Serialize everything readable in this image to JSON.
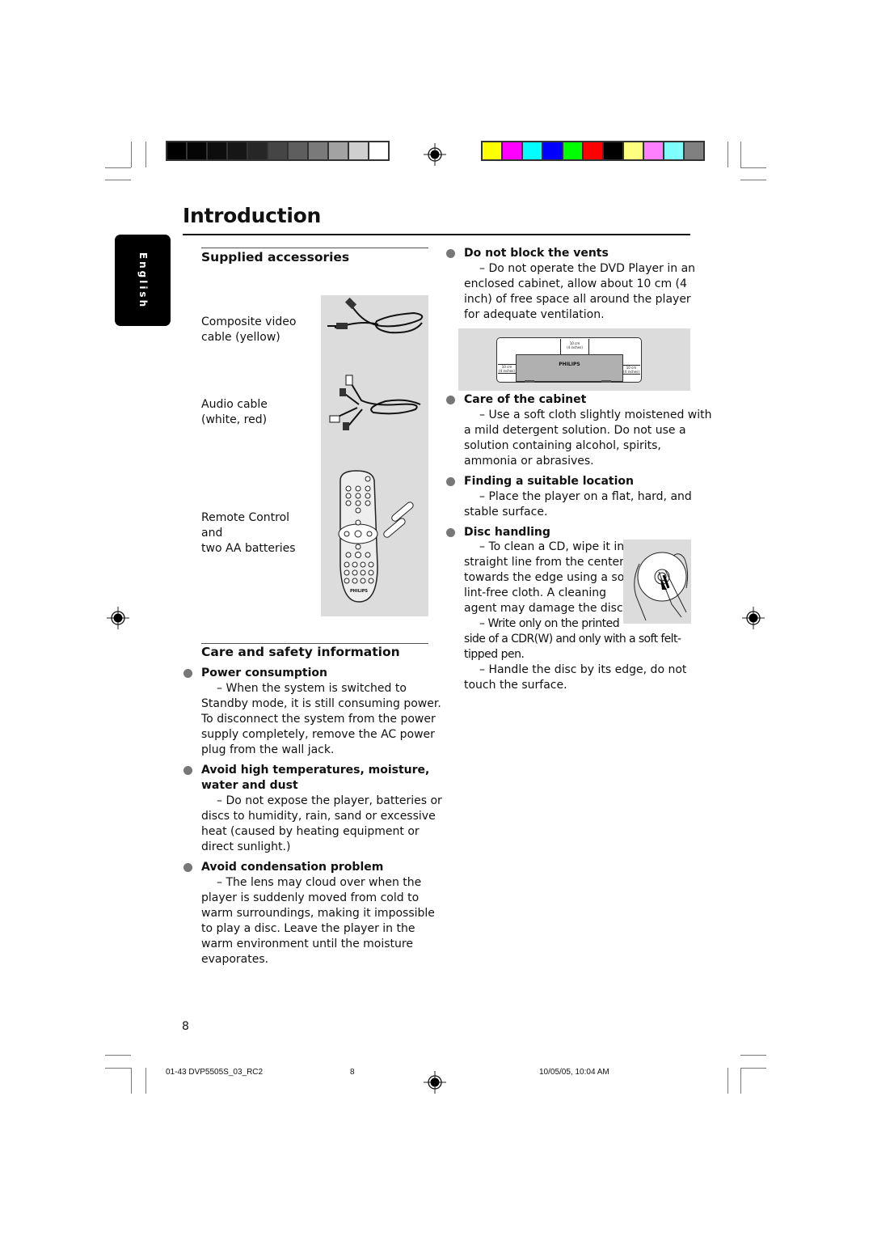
{
  "page": {
    "title": "Introduction",
    "language_tab": "English",
    "page_number": "8"
  },
  "color_bars": {
    "grayscale": [
      "#000000",
      "#050505",
      "#0d0d0d",
      "#161616",
      "#262626",
      "#454545",
      "#5e5e5e",
      "#7a7a7a",
      "#a2a2a2",
      "#cfcfcf",
      "#ffffff"
    ],
    "colors": [
      "#ffff00",
      "#ff00ff",
      "#00ffff",
      "#0000ff",
      "#00ff00",
      "#ff0000",
      "#000000",
      "#ffff80",
      "#ff80ff",
      "#80ffff",
      "#808080"
    ]
  },
  "supplied_accessories": {
    "heading": "Supplied accessories",
    "items": [
      {
        "label_line1": "Composite video",
        "label_line2": "cable (yellow)",
        "icon": "video-cable-icon"
      },
      {
        "label_line1": "Audio cable",
        "label_line2": "(white, red)",
        "icon": "audio-cable-icon"
      },
      {
        "label_line1": "Remote Control",
        "label_line2": "and",
        "label_line3": "two AA batteries",
        "icon": "remote-control-icon",
        "brand": "PHILIPS"
      }
    ]
  },
  "care_safety": {
    "heading": "Care and safety information",
    "items": [
      {
        "title": "Power consumption",
        "lines": [
          "–  When the system is switched to",
          "Standby mode, it is still consuming power.",
          "To disconnect the system from the power",
          "supply completely, remove the AC power",
          "plug from the wall jack."
        ]
      },
      {
        "title_line1": "Avoid high temperatures, moisture,",
        "title_line2": "water and dust",
        "lines": [
          "–  Do not expose the player, batteries or",
          "discs to humidity, rain, sand or excessive",
          "heat (caused by heating equipment or",
          "direct sunlight.)"
        ]
      },
      {
        "title": "Avoid condensation problem",
        "lines": [
          "–  The lens may cloud over when the",
          "player is suddenly moved from cold to",
          "warm surroundings, making it impossible",
          "to play a disc. Leave the player in the",
          "warm environment until the moisture",
          "evaporates."
        ]
      }
    ]
  },
  "right_column": {
    "vents": {
      "title": "Do not block the vents",
      "lines": [
        "–  Do not operate the DVD Player in an",
        "enclosed cabinet,  allow about 10 cm (4",
        "inch) of free space all around the player",
        "for adequate ventilation."
      ],
      "diagram": {
        "top": "10 cm",
        "top_sub": "(4 inches)",
        "left": "10 cm",
        "left_sub": "(4 inches)",
        "right": "10 cm",
        "right_sub": "(4 inches)",
        "brand": "PHILIPS"
      }
    },
    "cabinet": {
      "title": "Care of the cabinet",
      "lines": [
        "–  Use a soft cloth slightly moistened with",
        "a mild detergent solution. Do not use a",
        "solution containing alcohol, spirits,",
        "ammonia or abrasives."
      ]
    },
    "location": {
      "title": "Finding a suitable location",
      "lines": [
        "–  Place the player on a flat, hard, and",
        "stable surface."
      ]
    },
    "disc": {
      "title": "Disc handling",
      "lines_narrow": [
        "–  To clean a CD, wipe it in a",
        "straight line from the center",
        "towards the edge using a soft,",
        "lint-free cloth.  A cleaning",
        "agent may damage the disc!",
        "–  Write only on the printed"
      ],
      "lines_wide": [
        "side of a CDR(W) and only with a soft felt-",
        "tipped pen.",
        "–  Handle the disc by its edge, do not",
        "touch the surface."
      ]
    }
  },
  "footer": {
    "file": "01-43 DVP5505S_03_RC2",
    "page": "8",
    "timestamp": "10/05/05, 10:04 AM"
  }
}
